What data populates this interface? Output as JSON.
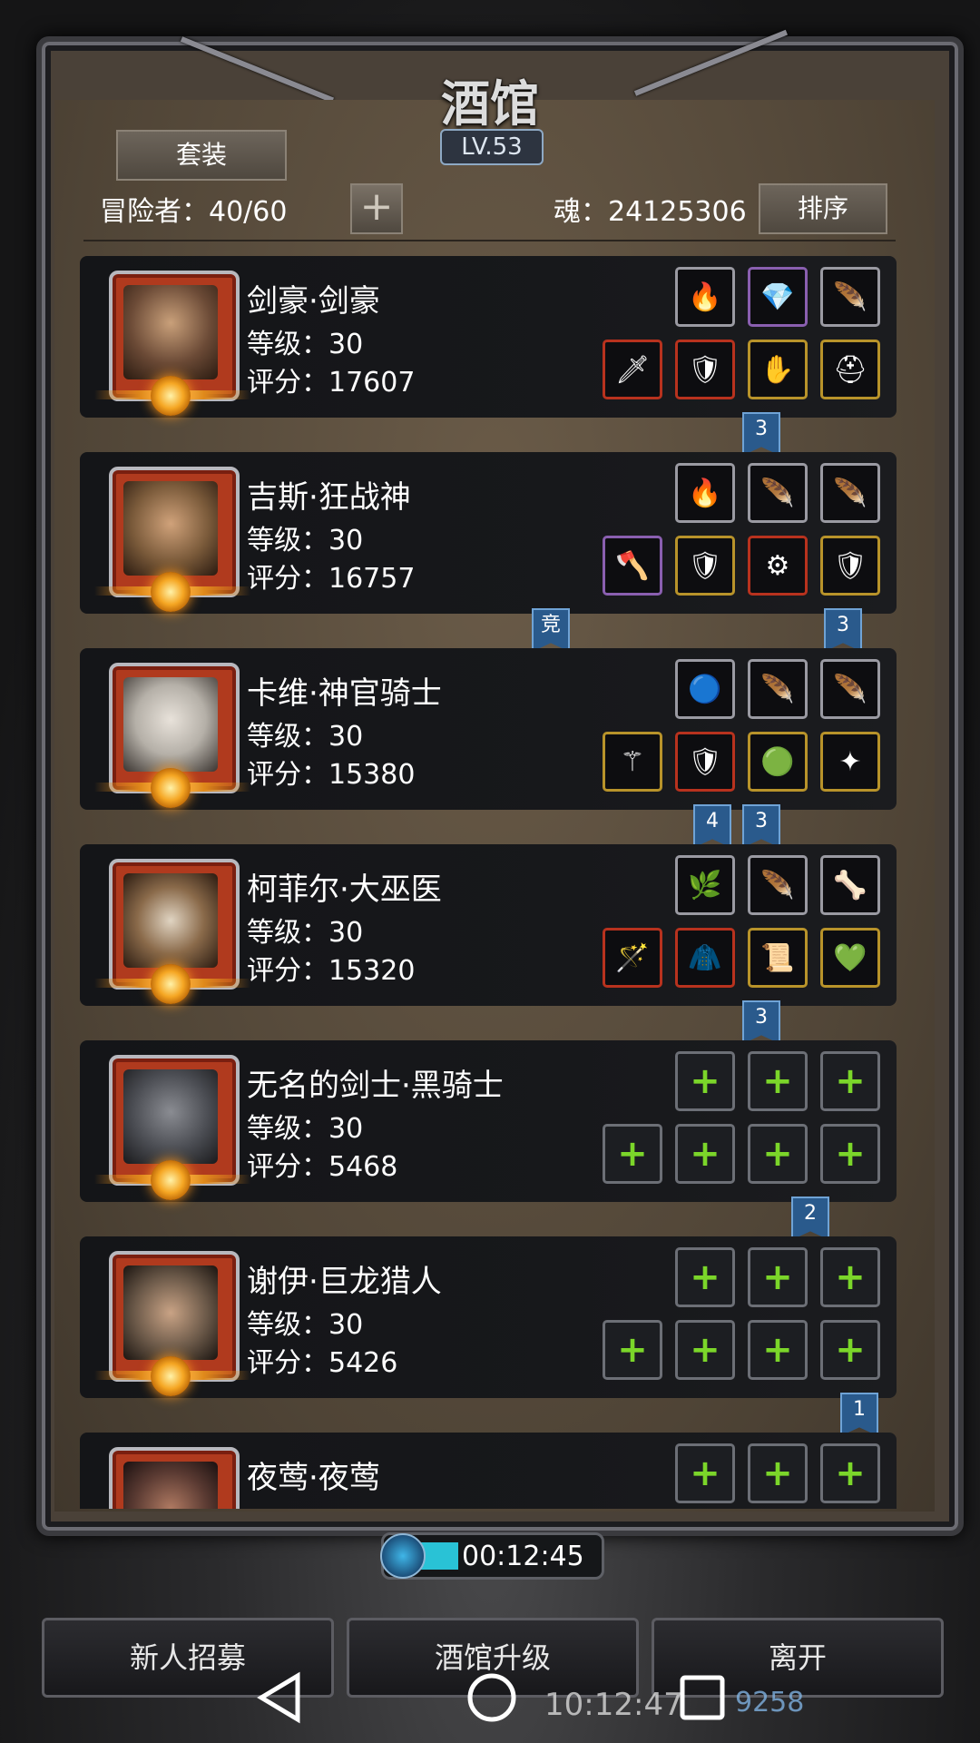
{
  "title": "酒馆",
  "level": "LV.53",
  "set_button": "套装",
  "adventurers_label": "冒险者：40/60",
  "add_button": "+",
  "soul_label": "魂：24125306",
  "sort_button": "排序",
  "heroes": [
    {
      "name": "剑豪·剑豪",
      "level": "等级：30",
      "score": "评分：17607",
      "tone": "#6b4a36"
    },
    {
      "name": "吉斯·狂战神",
      "level": "等级：30",
      "score": "评分：16757",
      "tone": "#7a5a3a"
    },
    {
      "name": "卡维·神官骑士",
      "level": "等级：30",
      "score": "评分：15380",
      "tone": "#b5b0a8"
    },
    {
      "name": "柯菲尔·大巫医",
      "level": "等级：30",
      "score": "评分：15320",
      "tone": "#8a6a4a"
    },
    {
      "name": "无名的剑士·黑骑士",
      "level": "等级：30",
      "score": "评分：5468",
      "tone": "#4a4c52"
    },
    {
      "name": "谢伊·巨龙猎人",
      "level": "等级：30",
      "score": "评分：5426",
      "tone": "#6a5848"
    },
    {
      "name": "夜莺·夜莺",
      "level": "",
      "score": "",
      "tone": "#5a3a32"
    }
  ],
  "ribbons": [
    {
      "text": "3"
    },
    {
      "text": "竞"
    },
    {
      "text": "3"
    },
    {
      "text": "4"
    },
    {
      "text": "3"
    },
    {
      "text": "3"
    },
    {
      "text": "2"
    },
    {
      "text": "1"
    }
  ],
  "timer": "00:12:45",
  "buttons": {
    "recruit": "新人招募",
    "upgrade": "酒馆升级",
    "leave": "离开"
  },
  "background_clock": "10:12:47",
  "background_number": "9258"
}
